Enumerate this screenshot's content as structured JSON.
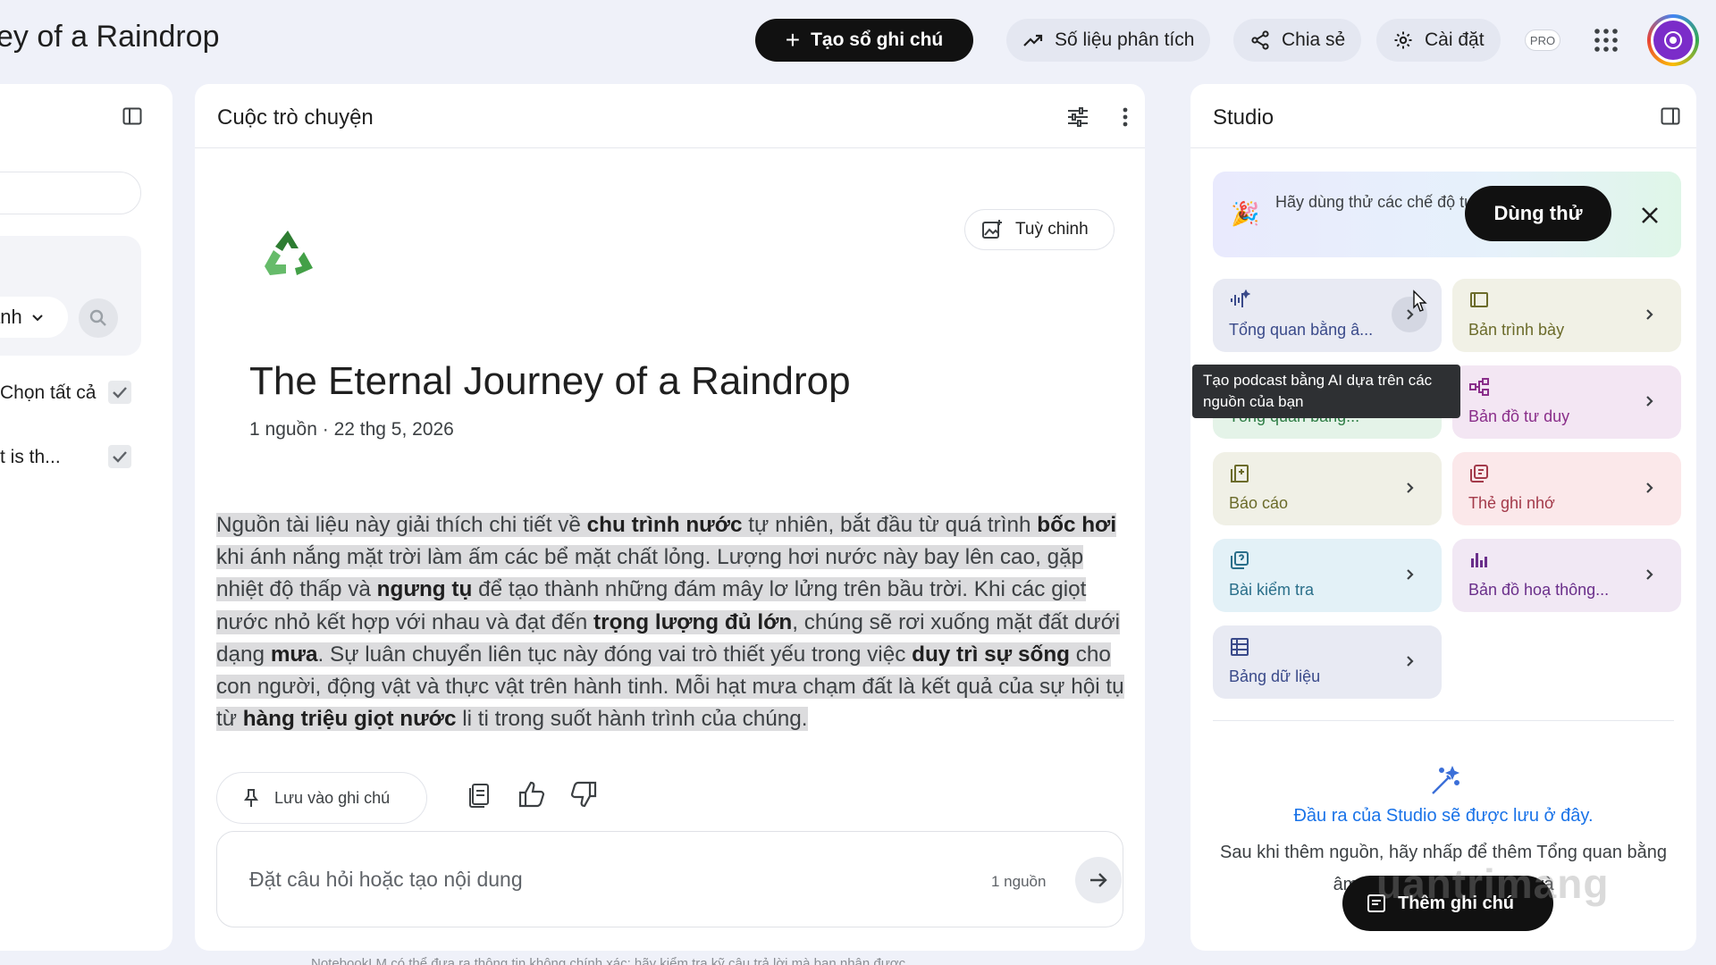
{
  "header": {
    "title": "ey of a Raindrop",
    "create_button": "Tạo sổ ghi chú",
    "analytics_button": "Số liệu phân tích",
    "share_button": "Chia sẻ",
    "settings_button": "Cài đặt",
    "pro_badge": "PRO"
  },
  "sources": {
    "dropdown_label": "anh",
    "select_all": "Chọn tất cả",
    "source_item": "t is th..."
  },
  "chat": {
    "panel_title": "Cuộc trò chuyện",
    "customize_button": "Tuỳ chinh",
    "notebook_title": "The Eternal Journey of a Raindrop",
    "notebook_meta": "1 nguồn · 22 thg 5, 2026",
    "summary": {
      "t1": "Nguồn tài liệu này giải thích chi tiết về ",
      "b1": "chu trình nước",
      "t2": " tự nhiên, bắt đầu từ quá trình ",
      "b2": "bốc hơi",
      "t3": " khi ánh nắng mặt trời làm ấm các bể mặt chất lỏng. Lượng hơi nước này bay lên cao, gặp nhiệt độ thấp và ",
      "b3": "ngưng tụ",
      "t4": " để tạo thành những đám mây lơ lửng trên bầu trời. Khi các giọt nước nhỏ kết hợp với nhau và đạt đến ",
      "b4": "trọng lượng đủ lớn",
      "t5": ", chúng sẽ rơi xuống mặt đất dưới dạng ",
      "b5": "mưa",
      "t6": ". Sự luân chuyển liên tục này đóng vai trò thiết yếu trong việc ",
      "b6": "duy trì sự sống",
      "t7": " cho con người, động vật và thực vật trên hành tinh. Mỗi hạt mưa chạm đất là kết quả của sự hội tụ từ ",
      "b7": "hàng triệu giọt nước",
      "t8": " li ti trong suốt hành trình của chúng."
    },
    "save_note_button": "Lưu vào ghi chú",
    "input_placeholder": "Đặt câu hỏi hoặc tạo nội dung",
    "source_count": "1 nguồn",
    "footer_note": "NotebookLM có thể đưa ra thông tin không chính xác; hãy kiểm tra kỹ câu trả lời mà bạn nhận được."
  },
  "studio": {
    "panel_title": "Studio",
    "banner_text": "Hãy dùng thử các chế độ tuỳ chỉnh mới của Bản đồ tư duy",
    "banner_button": "Dùng thử",
    "tiles": [
      {
        "label": "Tổng quan bằng â...",
        "color": "#e8eaf3",
        "icon": "audio-waveform-icon"
      },
      {
        "label": "Bản trình bày",
        "color": "#f1f1e6",
        "icon": "slides-icon"
      },
      {
        "label": "Tổng quan bằng...",
        "color": "#e4f3e8",
        "icon": "video-icon"
      },
      {
        "label": "Bản đồ tư duy",
        "color": "#f3e6f3",
        "icon": "mindmap-icon"
      },
      {
        "label": "Báo cáo",
        "color": "#f0f0e6",
        "icon": "report-icon"
      },
      {
        "label": "Thẻ ghi nhớ",
        "color": "#fbe8ea",
        "icon": "flashcard-icon"
      },
      {
        "label": "Bài kiểm tra",
        "color": "#e3f1f7",
        "icon": "quiz-icon"
      },
      {
        "label": "Bản đồ hoạ thông...",
        "color": "#f1e8f4",
        "icon": "infographic-icon"
      },
      {
        "label": "Bảng dữ liệu",
        "color": "#e8eaf3",
        "icon": "table-icon"
      }
    ],
    "tooltip": "Tạo podcast bằng AI dựa trên các nguồn của bạn",
    "output_title": "Đầu ra của Studio sẽ được lưu ở đây.",
    "output_desc": "Sau khi thêm nguồn, hãy nhấp để thêm Tổng quan bằng âm thanh, Bản đồ tư duy và",
    "add_note_button": "Thêm ghi chú",
    "watermark": "uantrimang"
  }
}
